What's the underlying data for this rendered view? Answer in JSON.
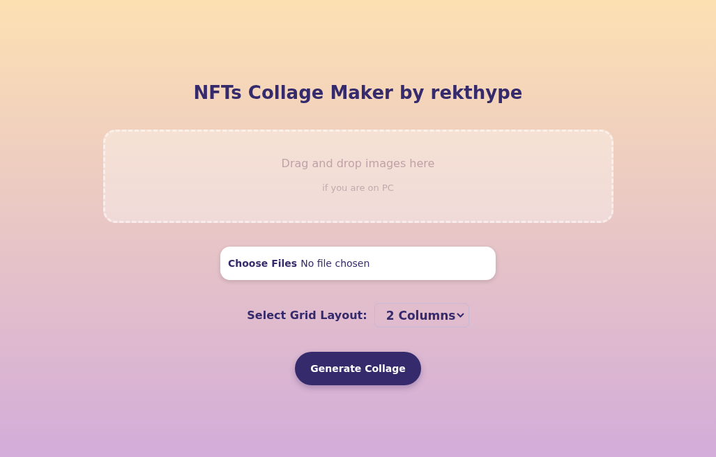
{
  "title": "NFTs Collage Maker by rekthype",
  "dropzone": {
    "text": "Drag and drop images here",
    "hint": "if you are on PC"
  },
  "file_input": {
    "button": "Choose Files",
    "status": "No file chosen"
  },
  "grid_layout": {
    "label": "Select Grid Layout:",
    "value": "2 Columns"
  },
  "generate_button": "Generate Collage"
}
